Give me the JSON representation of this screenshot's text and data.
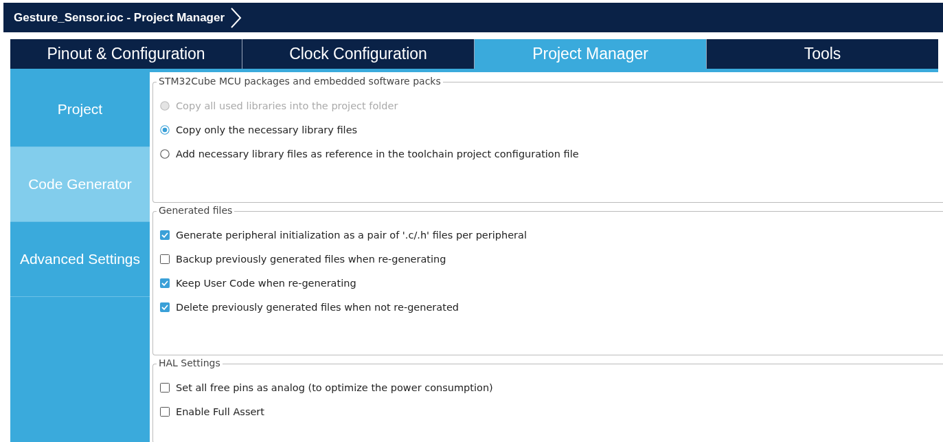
{
  "window": {
    "title": "Gesture_Sensor.ioc - Project Manager"
  },
  "tabs": [
    {
      "label": "Pinout & Configuration",
      "selected": false
    },
    {
      "label": "Clock Configuration",
      "selected": false
    },
    {
      "label": "Project Manager",
      "selected": true
    },
    {
      "label": "Tools",
      "selected": false
    }
  ],
  "sidebar": {
    "items": [
      {
        "label": "Project",
        "selected": false
      },
      {
        "label": "Code Generator",
        "selected": true
      },
      {
        "label": "Advanced Settings",
        "selected": false
      }
    ]
  },
  "sections": [
    {
      "title": "STM32Cube MCU packages and embedded software packs",
      "kind": "radio",
      "options": [
        {
          "label": "Copy all used libraries into the project folder",
          "selected": false,
          "disabled": true
        },
        {
          "label": "Copy only the necessary library files",
          "selected": true,
          "disabled": false
        },
        {
          "label": "Add necessary library files as reference in the toolchain project configuration file",
          "selected": false,
          "disabled": false
        }
      ]
    },
    {
      "title": "Generated files",
      "kind": "checkbox",
      "options": [
        {
          "label": "Generate peripheral initialization as a pair of '.c/.h' files per peripheral",
          "checked": true
        },
        {
          "label": "Backup previously generated files when re-generating",
          "checked": false
        },
        {
          "label": "Keep User Code when re-generating",
          "checked": true
        },
        {
          "label": "Delete previously generated files when not re-generated",
          "checked": true
        }
      ]
    },
    {
      "title": "HAL Settings",
      "kind": "checkbox",
      "options": [
        {
          "label": "Set all free pins as analog (to optimize the power consumption)",
          "checked": false
        },
        {
          "label": "Enable Full Assert",
          "checked": false
        }
      ]
    }
  ]
}
